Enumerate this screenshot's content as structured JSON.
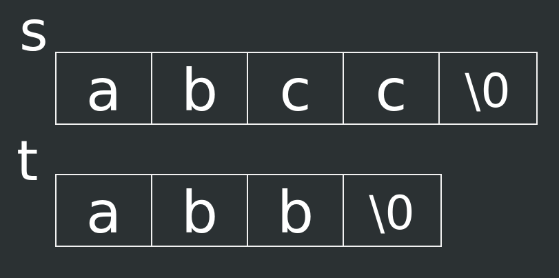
{
  "labels": {
    "s": "s",
    "t": "t"
  },
  "arrays": {
    "s": [
      "a",
      "b",
      "c",
      "c",
      "\\0"
    ],
    "t": [
      "a",
      "b",
      "b",
      "\\0"
    ]
  },
  "colors": {
    "background": "#2b3133",
    "line": "#f2f2f2",
    "text": "#ffffff"
  }
}
